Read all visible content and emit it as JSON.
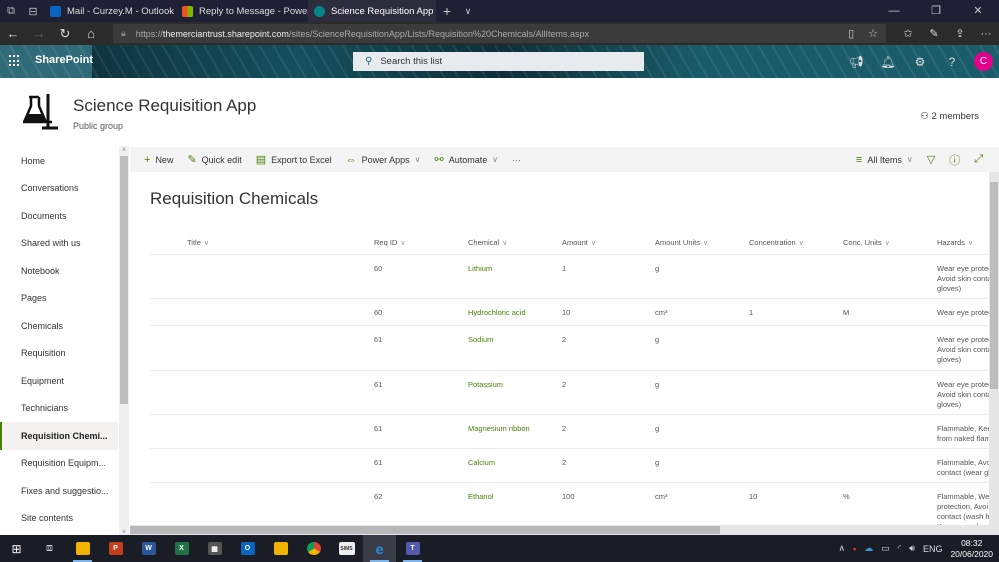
{
  "browser": {
    "tabs": [
      {
        "label": "Mail - Curzey.M - Outlook",
        "icon": "outlook-icon",
        "color": "#0a64c2",
        "active": false
      },
      {
        "label": "Reply to Message - Power P",
        "icon": "microsoft-icon",
        "color": "#f25022",
        "active": false
      },
      {
        "label": "Science Requisition App",
        "icon": "sharepoint-icon",
        "color": "#038387",
        "active": true
      }
    ],
    "close_glyph": "✕",
    "new_tab_glyph": "+",
    "tab_list_glyph": "⌄",
    "url_host": "https://themerciantrust.sharepoint.com",
    "url_path": "/sites/ScienceRequisitionApp/Lists/Requisition%20Chemicals/AllItems.aspx",
    "url_prefix": "https://",
    "url_domain": "themerciantrust.sharepoint.com"
  },
  "suite": {
    "app_name": "SharePoint",
    "search_placeholder": "Search this list",
    "avatar_initial": "C"
  },
  "site": {
    "title": "Science Requisition App",
    "subtitle": "Public group",
    "members": "2 members"
  },
  "nav": {
    "items": [
      {
        "label": "Home"
      },
      {
        "label": "Conversations"
      },
      {
        "label": "Documents"
      },
      {
        "label": "Shared with us"
      },
      {
        "label": "Notebook"
      },
      {
        "label": "Pages"
      },
      {
        "label": "Chemicals"
      },
      {
        "label": "Requisition"
      },
      {
        "label": "Equipment"
      },
      {
        "label": "Technicians"
      },
      {
        "label": "Requisition Chemi...",
        "active": true
      },
      {
        "label": "Requisition Equipm..."
      },
      {
        "label": "Fixes and suggestio..."
      },
      {
        "label": "Site contents"
      }
    ]
  },
  "commands": {
    "new": "New",
    "quick_edit": "Quick edit",
    "export": "Export to Excel",
    "power_apps": "Power Apps",
    "automate": "Automate",
    "more": "···",
    "view": "All Items"
  },
  "list": {
    "title": "Requisition Chemicals",
    "columns": [
      "Title",
      "Req ID",
      "Chemical",
      "Amount",
      "Amount Units",
      "Concentration",
      "Conc. Units",
      "Hazards"
    ],
    "rows": [
      {
        "title": "",
        "req_id": "60",
        "chemical": "Lithium",
        "amount": "1",
        "amount_units": "g",
        "concentration": "",
        "conc_units": "",
        "hazards": "Wear eye protec Avoid skin conta gloves)"
      },
      {
        "title": "",
        "req_id": "60",
        "chemical": "Hydrochloric acid",
        "amount": "10",
        "amount_units": "cm³",
        "concentration": "1",
        "conc_units": "M",
        "hazards": "Wear eye protec"
      },
      {
        "title": "",
        "req_id": "61",
        "chemical": "Sodium",
        "amount": "2",
        "amount_units": "g",
        "concentration": "",
        "conc_units": "",
        "hazards": "Wear eye protec Avoid skin conta gloves)"
      },
      {
        "title": "",
        "req_id": "61",
        "chemical": "Potassium",
        "amount": "2",
        "amount_units": "g",
        "concentration": "",
        "conc_units": "",
        "hazards": "Wear eye protec Avoid skin conta gloves)"
      },
      {
        "title": "",
        "req_id": "61",
        "chemical": "Magnesium ribbon",
        "amount": "2",
        "amount_units": "g",
        "concentration": "",
        "conc_units": "",
        "hazards": "Flammable, Kee from naked flam"
      },
      {
        "title": "",
        "req_id": "61",
        "chemical": "Calcium",
        "amount": "2",
        "amount_units": "g",
        "concentration": "",
        "conc_units": "",
        "hazards": "Flammable, Avo contact (wear gl"
      },
      {
        "title": "",
        "req_id": "62",
        "chemical": "Ethanol",
        "amount": "100",
        "amount_units": "cm³",
        "concentration": "10",
        "conc_units": "%",
        "hazards": "Flammable, Wea protection, Avoi contact (wash h. Keep away from"
      }
    ]
  },
  "taskbar": {
    "apps": [
      {
        "name": "file-explorer",
        "label": "",
        "color": "#f0b400"
      },
      {
        "name": "powerpoint",
        "label": "P",
        "color": "#c43e1c"
      },
      {
        "name": "word",
        "label": "W",
        "color": "#2b579a"
      },
      {
        "name": "excel",
        "label": "X",
        "color": "#217346"
      },
      {
        "name": "calculator",
        "label": "▦",
        "color": "#555"
      },
      {
        "name": "outlook",
        "label": "O",
        "color": "#0a64c2"
      },
      {
        "name": "file-explorer-2",
        "label": "",
        "color": "#f0b400"
      },
      {
        "name": "chrome",
        "label": "",
        "color": "#db4437"
      },
      {
        "name": "sims",
        "label": "SIMS",
        "color": "#eee"
      },
      {
        "name": "edge",
        "label": "e",
        "color": "#1e90e0"
      },
      {
        "name": "teams",
        "label": "T",
        "color": "#5558af"
      }
    ],
    "language": "ENG",
    "time": "08:32",
    "date": "20/06/2020"
  }
}
